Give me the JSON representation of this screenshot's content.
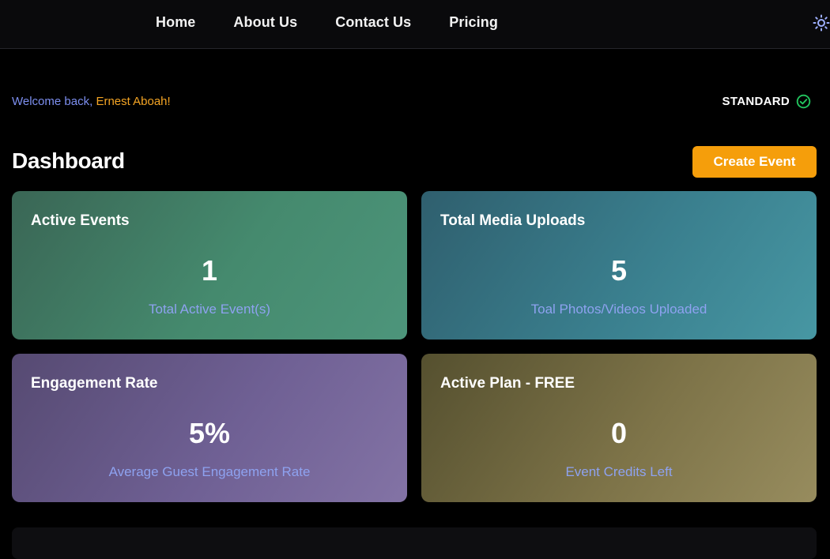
{
  "nav": {
    "links": [
      "Home",
      "About Us",
      "Contact Us",
      "Pricing"
    ],
    "theme_icon": "sun-icon"
  },
  "welcome": {
    "prefix": "Welcome back, ",
    "user_name": "Ernest Aboah!"
  },
  "plan_badge": {
    "label": "STANDARD",
    "icon": "check-circle-icon",
    "color": "#22c55e"
  },
  "dashboard": {
    "title": "Dashboard",
    "create_button": "Create Event",
    "cards": [
      {
        "title": "Active Events",
        "value": "1",
        "caption": "Total Active Event(s)"
      },
      {
        "title": "Total Media Uploads",
        "value": "5",
        "caption": "Toal Photos/Videos Uploaded"
      },
      {
        "title": "Engagement Rate",
        "value": "5%",
        "caption": "Average Guest Engagement Rate"
      },
      {
        "title": "Active Plan - FREE",
        "value": "0",
        "caption": "Event Credits Left"
      }
    ]
  },
  "colors": {
    "accent": "#f59e0b",
    "welcome_text": "#7d8ff0",
    "user_name": "#f5a524",
    "caption": "#8ea2f0"
  }
}
